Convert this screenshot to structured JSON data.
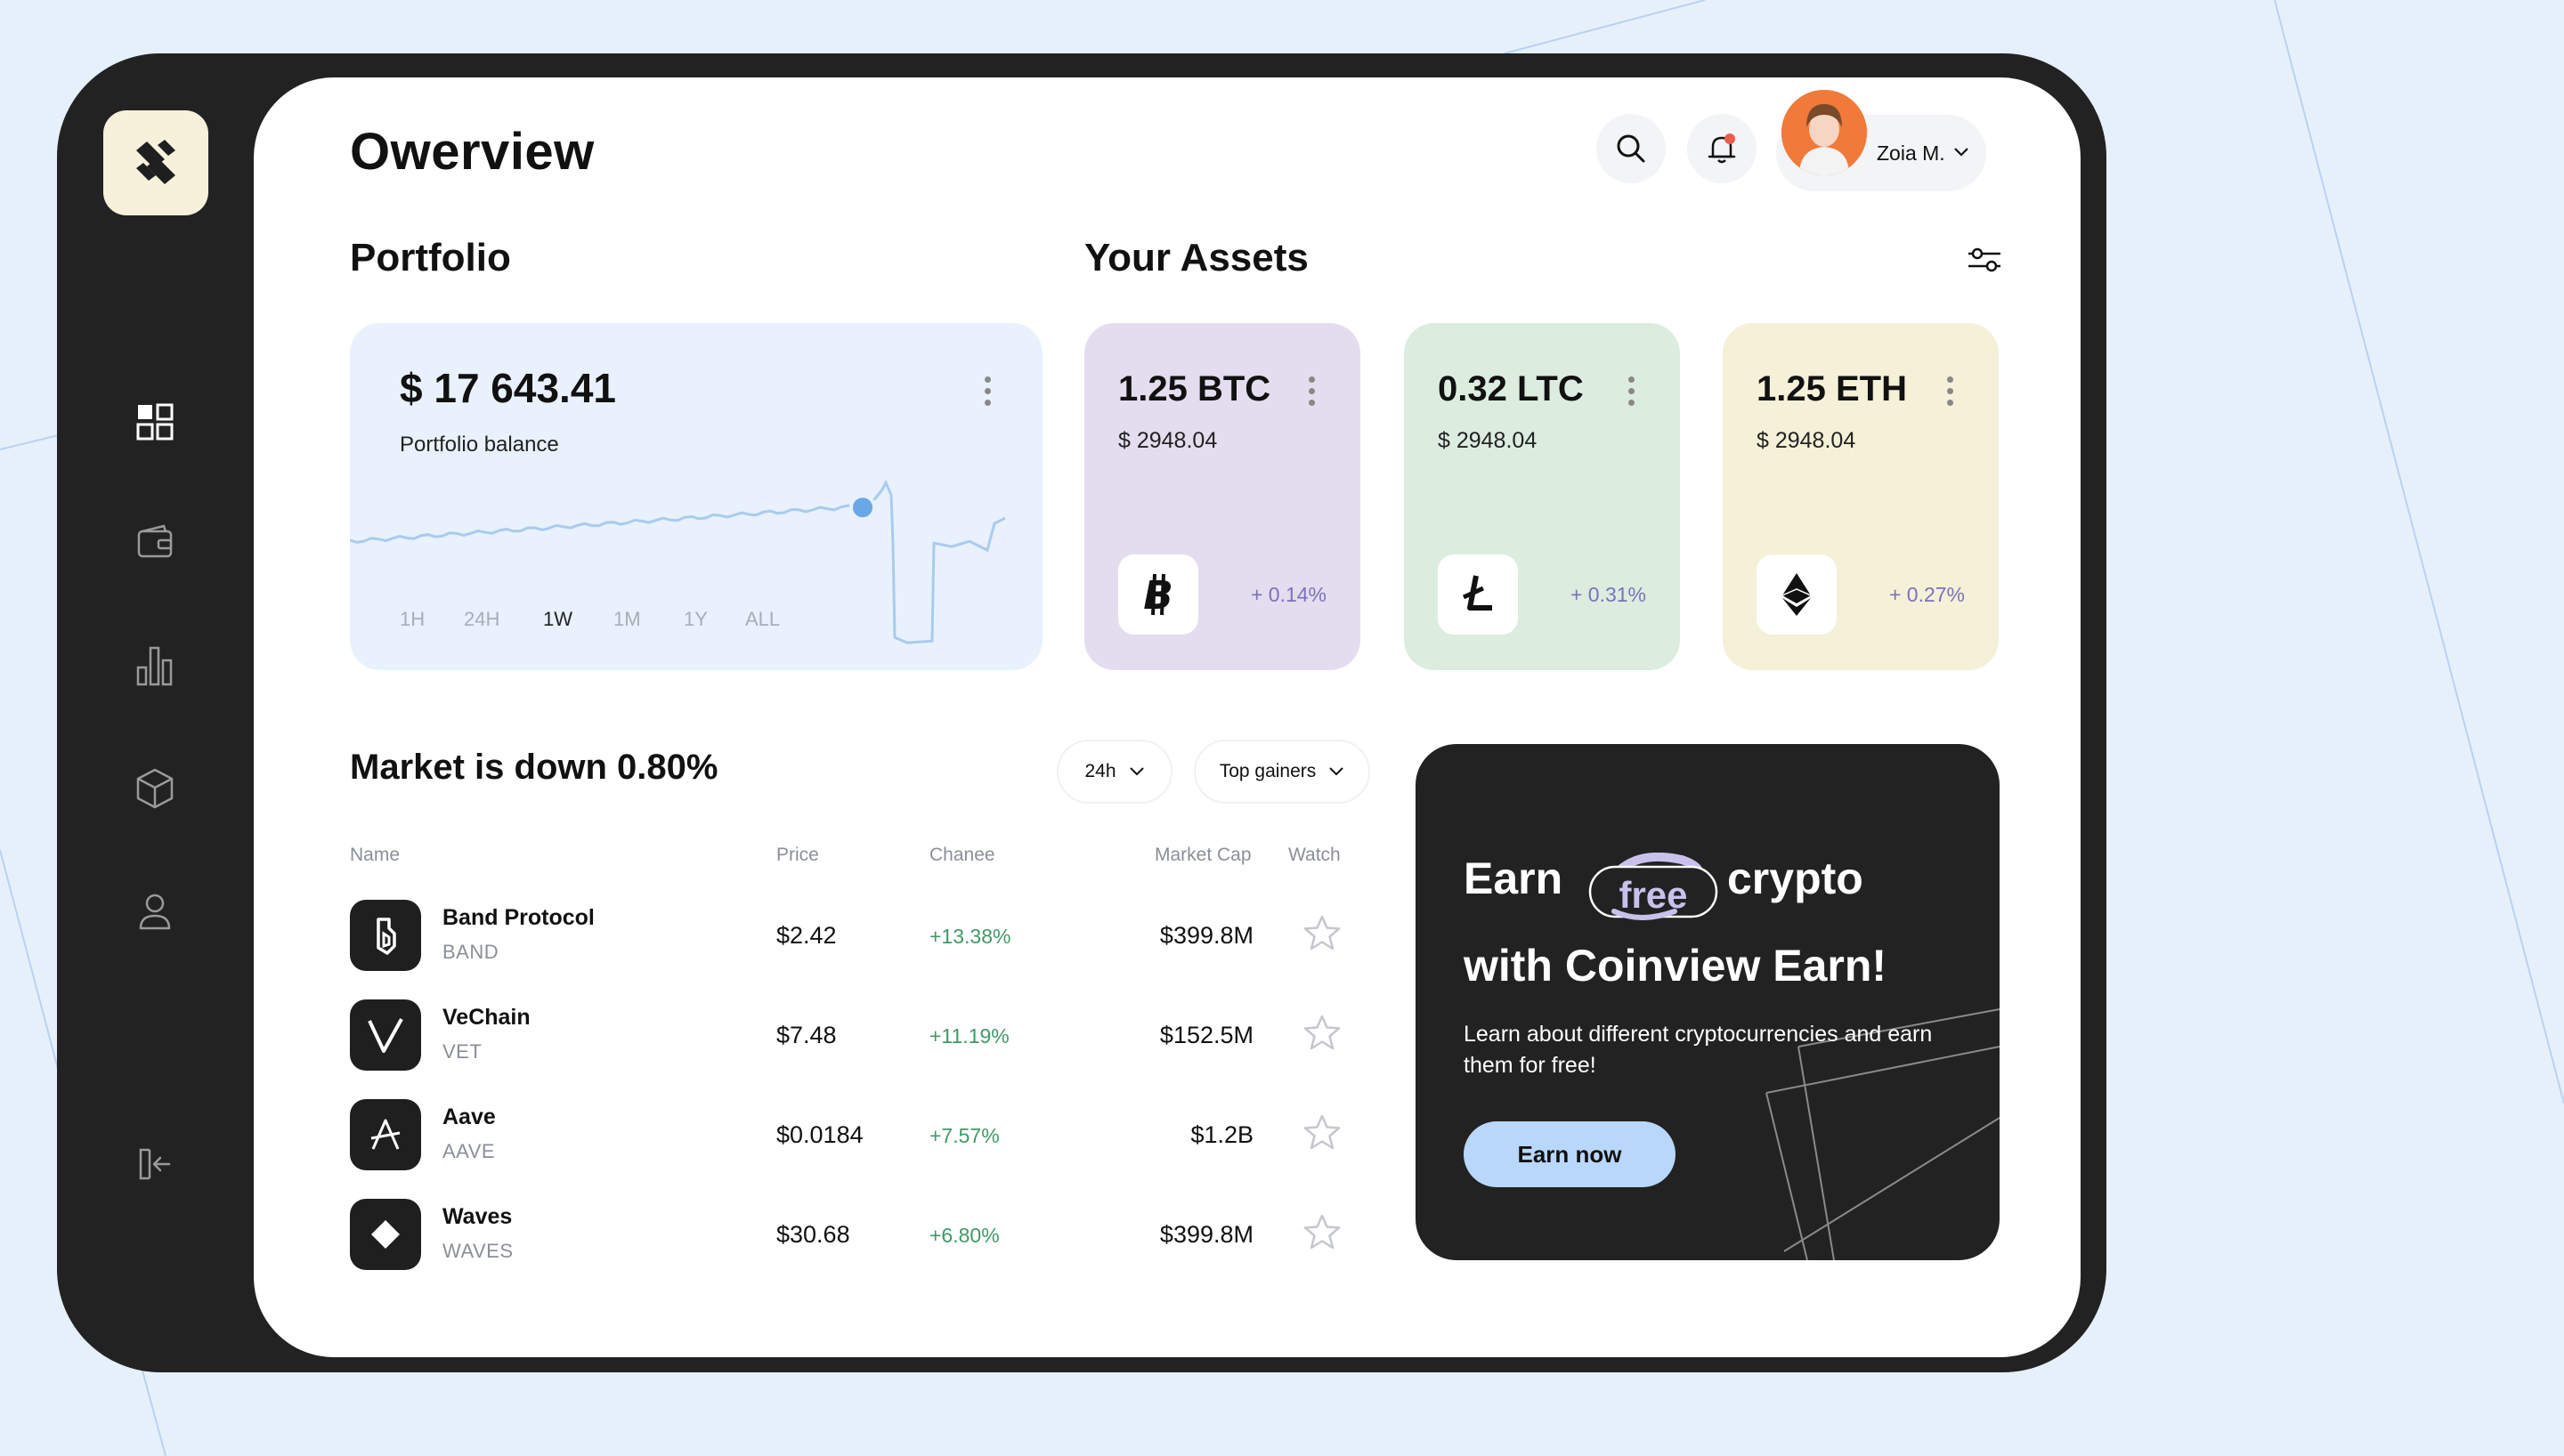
{
  "colors": {
    "page_bg": "#e6f0fb",
    "frame": "#222222",
    "portfolio_card": "#e8f1fc",
    "btc_card": "#e3ddef",
    "ltc_card": "#dcede0",
    "eth_card": "#f5f0d8",
    "positive_change": "#3f9a67",
    "asset_change": "#7a73b8",
    "earn_button": "#b9d7fb",
    "chart_line": "#a9cbee",
    "chart_marker": "#6aa7e6"
  },
  "sidebar": {
    "logo_icon": "stripes-logo-icon",
    "items": [
      {
        "icon": "grid-icon"
      },
      {
        "icon": "wallet-icon"
      },
      {
        "icon": "bar-chart-icon"
      },
      {
        "icon": "cube-icon"
      },
      {
        "icon": "user-icon"
      },
      {
        "icon": "logout-icon"
      }
    ]
  },
  "header": {
    "title": "Owerview",
    "search_icon": "search-icon",
    "notification_icon": "bell-icon",
    "user": {
      "name": "Zoia M."
    }
  },
  "portfolio": {
    "section_title": "Portfolio",
    "balance": "$ 17 643.41",
    "balance_label": "Portfolio balance",
    "timeframes": [
      "1H",
      "24H",
      "1W",
      "1M",
      "1Y",
      "ALL"
    ],
    "active_timeframe": "1W"
  },
  "assets": {
    "section_title": "Your Assets",
    "cards": [
      {
        "amount": "1.25 BTC",
        "usd": "$ 2948.04",
        "change": "+ 0.14%",
        "icon": "bitcoin-icon"
      },
      {
        "amount": "0.32 LTC",
        "usd": "$ 2948.04",
        "change": "+ 0.31%",
        "icon": "litecoin-icon"
      },
      {
        "amount": "1.25 ETH",
        "usd": "$ 2948.04",
        "change": "+ 0.27%",
        "icon": "ethereum-icon"
      }
    ]
  },
  "market": {
    "title": "Market is down 0.80%",
    "period_filter": "24h",
    "sort_filter": "Top gainers",
    "columns": {
      "name": "Name",
      "price": "Price",
      "change": "Chanee",
      "market_cap": "Market Cap",
      "watch": "Watch"
    },
    "rows": [
      {
        "name": "Band Protocol",
        "ticker": "BAND",
        "price": "$2.42",
        "change": "+13.38%",
        "market_cap": "$399.8M",
        "icon": "band-protocol-icon"
      },
      {
        "name": "VeChain",
        "ticker": "VET",
        "price": "$7.48",
        "change": "+11.19%",
        "market_cap": "$152.5M",
        "icon": "vechain-icon"
      },
      {
        "name": "Aave",
        "ticker": "AAVE",
        "price": "$0.0184",
        "change": "+7.57%",
        "market_cap": "$1.2B",
        "icon": "aave-icon"
      },
      {
        "name": "Waves",
        "ticker": "WAVES",
        "price": "$30.68",
        "change": "+6.80%",
        "market_cap": "$399.8M",
        "icon": "waves-icon"
      }
    ]
  },
  "earn": {
    "word1": "Earn",
    "badge": "free",
    "word2": "crypto",
    "line2": "with Coinview Earn!",
    "description": "Learn about different cryptocurrencies and earn them for free!",
    "button": "Earn now"
  }
}
